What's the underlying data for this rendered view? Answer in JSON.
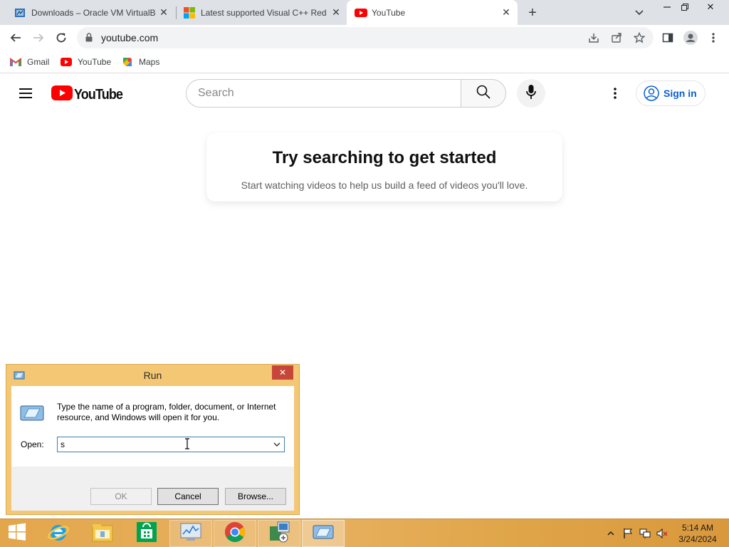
{
  "browser": {
    "tabs": [
      {
        "title": "Downloads – Oracle VM VirtualB",
        "icon": "virtualbox-icon",
        "active": false
      },
      {
        "title": "Latest supported Visual C++ Red",
        "icon": "microsoft-icon",
        "active": false
      },
      {
        "title": "YouTube",
        "icon": "youtube-icon",
        "active": true
      }
    ],
    "url": "youtube.com",
    "bookmarks": [
      {
        "label": "Gmail",
        "icon": "gmail-icon"
      },
      {
        "label": "YouTube",
        "icon": "youtube-icon"
      },
      {
        "label": "Maps",
        "icon": "maps-icon"
      }
    ]
  },
  "youtube": {
    "logo_text": "YouTube",
    "search_placeholder": "Search",
    "sign_in_label": "Sign in",
    "empty_title": "Try searching to get started",
    "empty_subtitle": "Start watching videos to help us build a feed of videos you'll love.",
    "brand_color": "#ff0000",
    "link_color": "#065fd4"
  },
  "run_dialog": {
    "title": "Run",
    "message": "Type the name of a program, folder, document, or Internet resource, and Windows will open it for you.",
    "open_label": "Open:",
    "open_value": "s",
    "ok_label": "OK",
    "cancel_label": "Cancel",
    "browse_label": "Browse..."
  },
  "taskbar": {
    "apps": [
      "start-icon",
      "internet-explorer-icon",
      "file-explorer-icon",
      "windows-store-icon",
      "task-manager-icon",
      "chrome-icon",
      "virtualbox-installer-icon",
      "run-icon"
    ],
    "time": "5:14 AM",
    "date": "3/24/2024",
    "accent_color": "#e3a64b"
  }
}
